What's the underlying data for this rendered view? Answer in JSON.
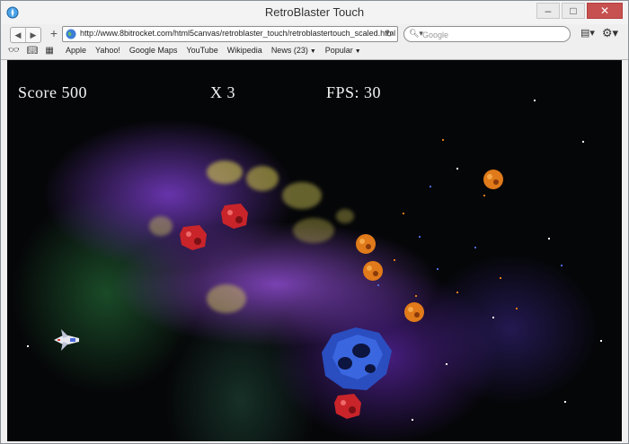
{
  "window": {
    "title": "RetroBlaster Touch",
    "controls": {
      "minimize": "–",
      "maximize": "□",
      "close": "✕"
    }
  },
  "toolbar": {
    "back_icon": "◀",
    "forward_icon": "▶",
    "new_tab_icon": "+",
    "url": "http://www.8bitrocket.com/html5canvas/retroblaster_touch/retroblastertouch_scaled.html",
    "reload_icon": "↻",
    "search_placeholder": "Google",
    "search_icon": "🔍︎▾",
    "page_menu_icon": "▤▾",
    "settings_icon": "⚙▾"
  },
  "bookmarks": {
    "icons": [
      "👓︎",
      "📖︎",
      "▦"
    ],
    "items": [
      {
        "label": "Apple"
      },
      {
        "label": "Yahoo!"
      },
      {
        "label": "Google Maps"
      },
      {
        "label": "YouTube"
      },
      {
        "label": "Wikipedia"
      },
      {
        "label": "News (23)",
        "has_menu": true
      },
      {
        "label": "Popular",
        "has_menu": true
      }
    ]
  },
  "game": {
    "hud": {
      "score": "Score 500",
      "lives": "X 3",
      "fps": "FPS: 30"
    }
  },
  "colors": {
    "background": "#050608",
    "nebula": "#7a3cc8",
    "rock_orange": "#e07a1a",
    "rock_red": "#c8242a",
    "rock_blue": "#2a4ec0"
  }
}
